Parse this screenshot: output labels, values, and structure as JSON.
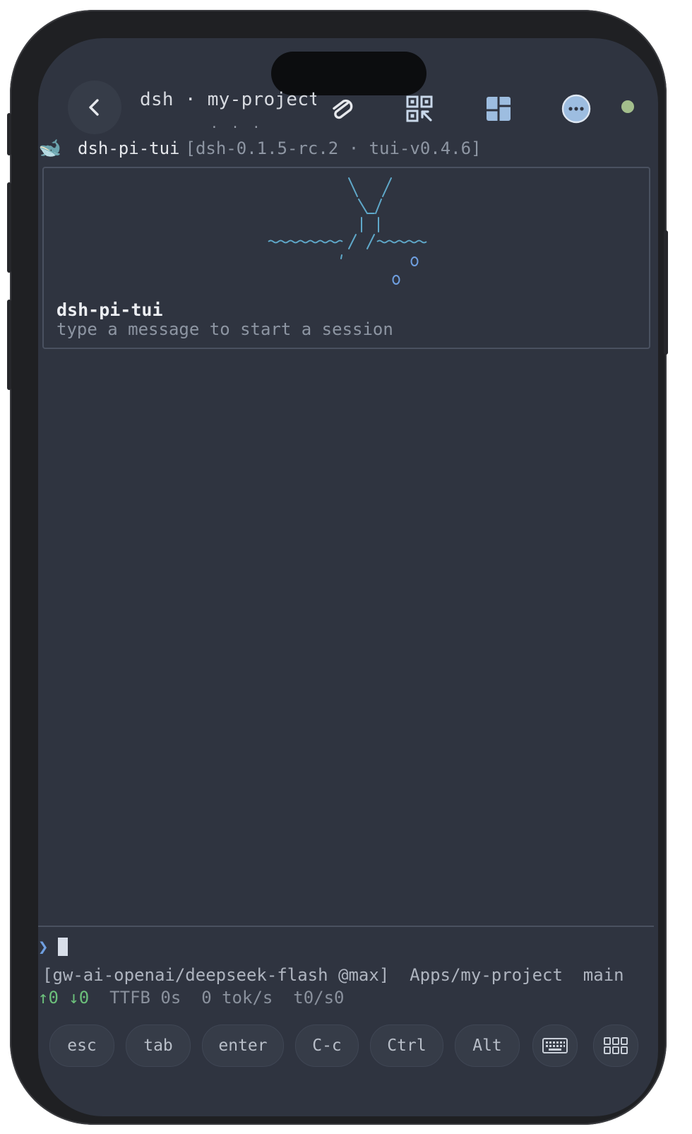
{
  "topbar": {
    "title": "dsh · my-project",
    "title_sub": "· · ·"
  },
  "header": {
    "whale_icon": "🐋",
    "app_name": "dsh-pi-tui",
    "version": "[dsh-0.1.5-rc.2 · tui-v0.4.6]"
  },
  "welcome": {
    "title": "dsh-pi-tui",
    "hint": "type a message to start a session"
  },
  "prompt": {
    "symbol": "❯"
  },
  "status": {
    "line1": "[gw-ai-openai/deepseek-flash @max]  Apps/my-project  main",
    "up": "↑0",
    "down": "↓0",
    "rest": "  TTFB 0s  0 tok/s  t0/s0"
  },
  "keys": {
    "esc": "esc",
    "tab": "tab",
    "enter": "enter",
    "ctrl_c": "C-c",
    "ctrl": "Ctrl",
    "alt": "Alt"
  },
  "colors": {
    "screen_bg": "#2f3440",
    "accent_blue": "#6f9fe0",
    "status_green": "#a3be8c",
    "art_cyan": "#5fa8c9"
  }
}
